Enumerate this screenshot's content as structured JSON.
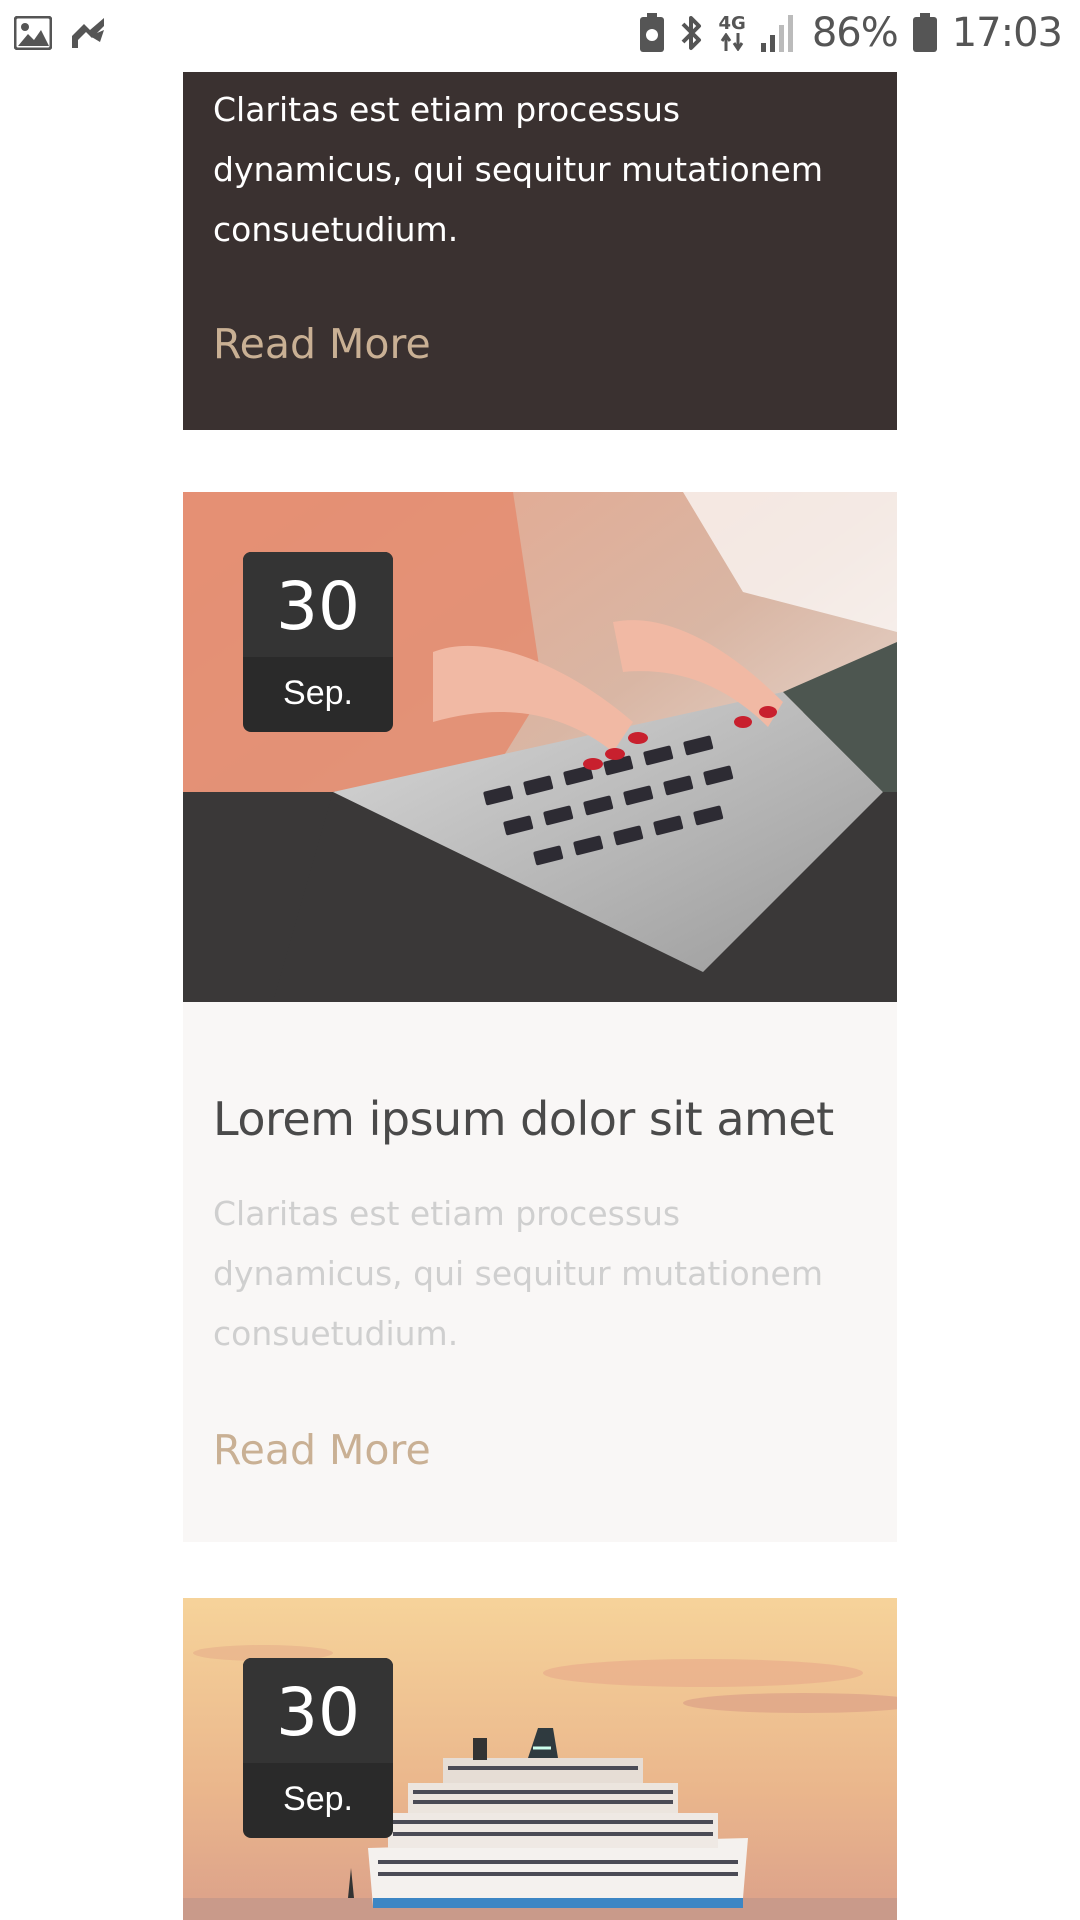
{
  "status_bar": {
    "network": "4G",
    "battery": "86%",
    "time": "17:03",
    "icons": [
      "image-icon",
      "app-icon",
      "battery-saver-icon",
      "bluetooth-icon",
      "data-arrows-icon",
      "signal-icon",
      "battery-icon"
    ]
  },
  "posts": [
    {
      "excerpt": "Claritas est etiam processus dynamicus, qui sequitur mutationem consuetudium.",
      "read_more": "Read More"
    },
    {
      "date_day": "30",
      "date_month": "Sep.",
      "image_icon": "laptop-typing-photo",
      "title": "Lorem ipsum dolor sit amet",
      "excerpt": "Claritas est etiam processus dynamicus, qui sequitur mutationem consuetudium.",
      "read_more": "Read More"
    },
    {
      "date_day": "30",
      "date_month": "Sep.",
      "image_icon": "cruise-ship-photo"
    }
  ],
  "colors": {
    "dark_card": "#3a3130",
    "accent": "#c9b094",
    "light_card": "#f9f7f6",
    "title": "#4a4a4a",
    "muted_text": "#cfcfcf"
  }
}
